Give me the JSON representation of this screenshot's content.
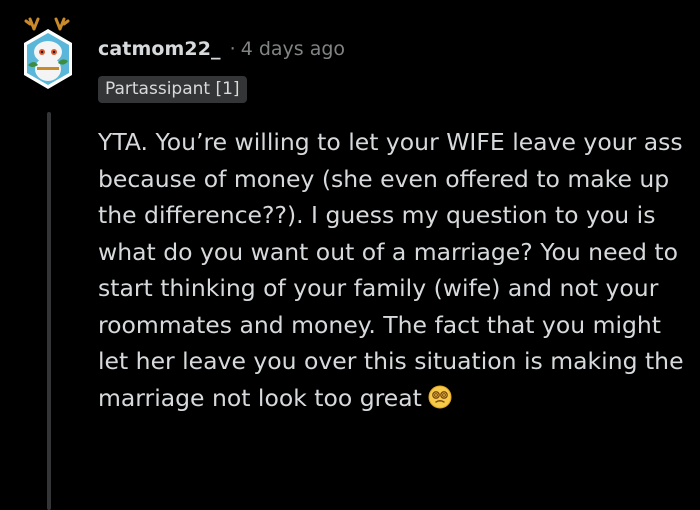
{
  "comment": {
    "username": "catmom22_",
    "separator": "·",
    "timestamp": "4 days ago",
    "flair": "Partassipant [1]",
    "body": "YTA. You’re willing to let your WIFE leave your ass because of money (she even offered to make up the difference??). I guess my question to you is what do you want out of a marriage? You need to start thinking of your family (wife) and not your roommates and money. The fact that you might let her leave you over this situation is making the marriage not look too great",
    "emoji": "dizzy-face-emoji"
  },
  "colors": {
    "background": "#000000",
    "text": "#d7dadc",
    "meta": "#818384",
    "flair_bg": "#343536",
    "thread_line": "#343536",
    "avatar_bg": "#5ab7d9",
    "avatar_accent": "#e25a2b"
  }
}
